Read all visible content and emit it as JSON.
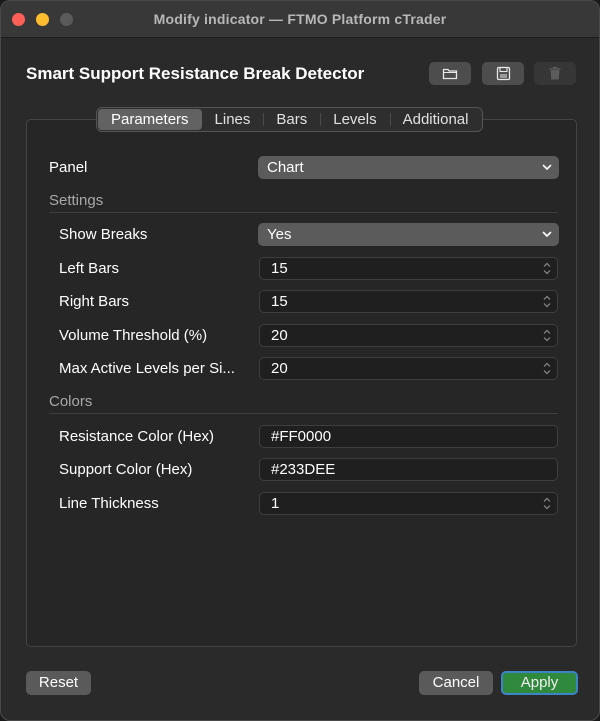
{
  "window": {
    "title": "Modify indicator — FTMO Platform cTrader"
  },
  "indicator": {
    "name": "Smart Support Resistance Break Detector"
  },
  "header_buttons": {
    "open_icon": "folder-icon",
    "save_icon": "floppy-disk-icon",
    "delete_icon": "trash-icon"
  },
  "tabs": [
    {
      "label": "Parameters",
      "active": true
    },
    {
      "label": "Lines",
      "active": false
    },
    {
      "label": "Bars",
      "active": false
    },
    {
      "label": "Levels",
      "active": false
    },
    {
      "label": "Additional",
      "active": false
    }
  ],
  "panel": {
    "label": "Panel",
    "value": "Chart"
  },
  "settings": {
    "section_label": "Settings",
    "show_breaks": {
      "label": "Show Breaks",
      "value": "Yes"
    },
    "left_bars": {
      "label": "Left Bars",
      "value": "15"
    },
    "right_bars": {
      "label": "Right Bars",
      "value": "15"
    },
    "volume_threshold": {
      "label": "Volume Threshold (%)",
      "value": "20"
    },
    "max_active_levels": {
      "label": "Max Active Levels per Si...",
      "value": "20"
    }
  },
  "colors": {
    "section_label": "Colors",
    "resistance": {
      "label": "Resistance Color (Hex)",
      "value": "#FF0000"
    },
    "support": {
      "label": "Support Color (Hex)",
      "value": "#233DEE"
    },
    "line_thickness": {
      "label": "Line Thickness",
      "value": "1"
    }
  },
  "footer": {
    "reset_label": "Reset",
    "cancel_label": "Cancel",
    "apply_label": "Apply"
  },
  "palette": {
    "apply_bg": "#2f8a3d",
    "focus_ring": "#3c84c8",
    "close": "#fe5f57",
    "minimize": "#febc2e"
  }
}
